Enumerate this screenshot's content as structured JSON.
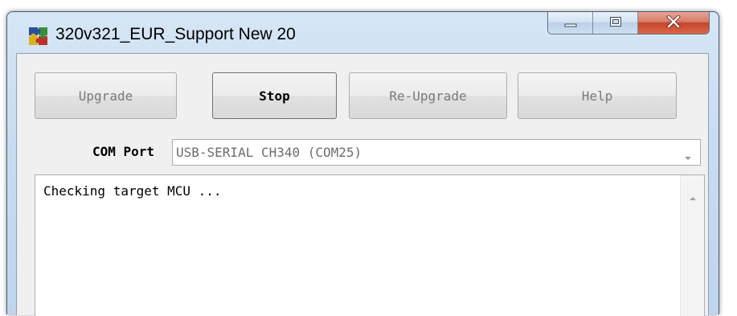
{
  "window": {
    "title": "320v321_EUR_Support New 20",
    "app_icon": "puzzle-app-icon",
    "caption_buttons": {
      "minimize_icon": "minimize-icon",
      "maximize_icon": "maximize-icon",
      "close_icon": "close-icon"
    }
  },
  "toolbar": {
    "upgrade_label": "Upgrade",
    "stop_label": "Stop",
    "reupgrade_label": "Re-Upgrade",
    "help_label": "Help"
  },
  "com_port": {
    "label": "COM Port",
    "selected": "USB-SERIAL CH340 (COM25)",
    "dropdown_icon": "chevron-down-icon"
  },
  "log": {
    "text": "Checking target MCU ...",
    "scroll_up_icon": "scroll-up-arrow-icon"
  },
  "colors": {
    "titlebar": "#c9ddf1",
    "client_bg": "#f0f0f0",
    "close_button": "#c7452c",
    "disabled_text": "#7a7a7a"
  }
}
